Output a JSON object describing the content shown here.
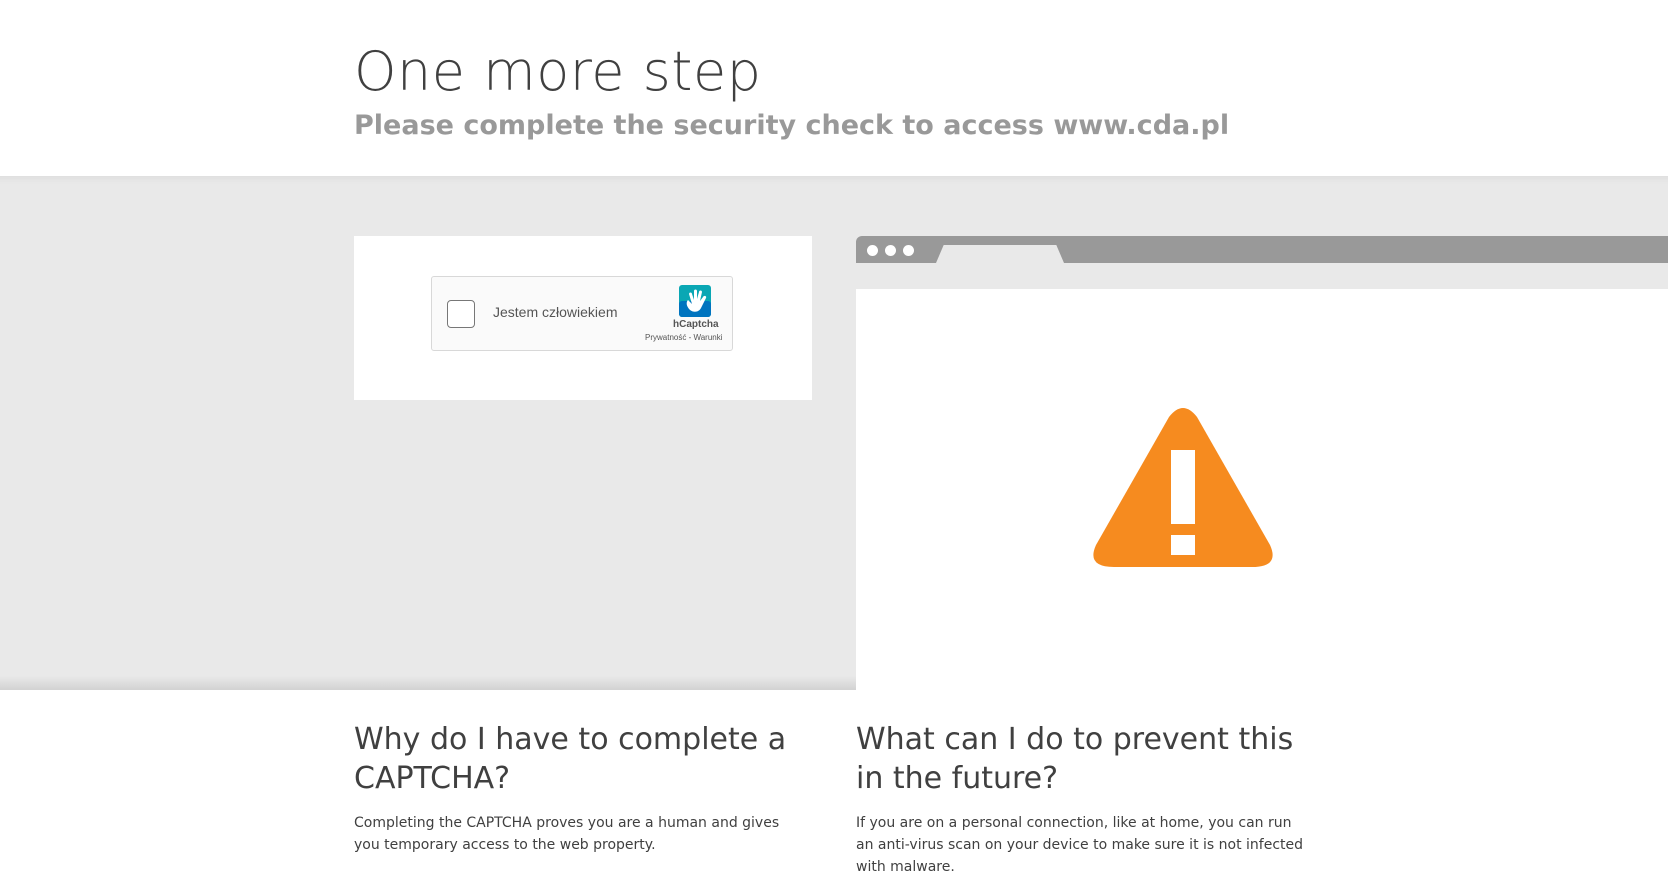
{
  "header": {
    "title": "One more step",
    "subtitle": "Please complete the security check to access www.cda.pl"
  },
  "captcha": {
    "checkbox_label": "Jestem człowiekiem",
    "brand": "hCaptcha",
    "privacy_link": "Prywatność",
    "separator": " - ",
    "terms_link": "Warunki"
  },
  "sections": {
    "why": {
      "heading": "Why do I have to complete a CAPTCHA?",
      "body": "Completing the CAPTCHA proves you are a human and gives you temporary access to the web property."
    },
    "prevent": {
      "heading": "What can I do to prevent this in the future?",
      "body": "If you are on a personal connection, like at home, you can run an anti-virus scan on your device to make sure it is not infected with malware."
    }
  },
  "colors": {
    "warning": "#f68b1f",
    "hcaptcha_teal": "#0074bf",
    "band": "#e9e9e9"
  },
  "icons": [
    "hcaptcha-logo-icon",
    "warning-triangle-icon",
    "browser-dot-icon"
  ]
}
